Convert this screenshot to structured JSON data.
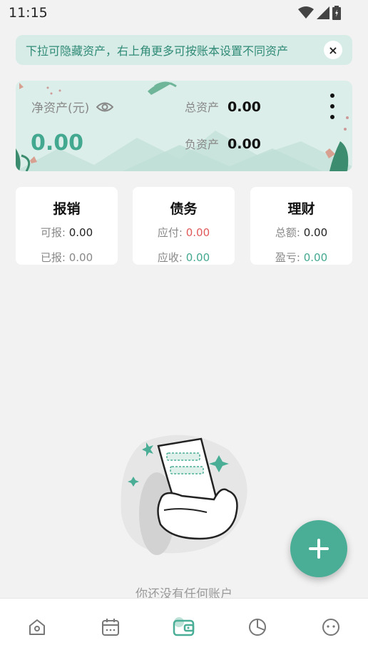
{
  "status_bar": {
    "time": "11:15"
  },
  "tip": {
    "text": "下拉可隐藏资产，右上角更多可按账本设置不同资产",
    "close_glyph": "×"
  },
  "assets": {
    "net_label": "净资产(元)",
    "net_value": "0.00",
    "total_label": "总资产",
    "total_value": "0.00",
    "debt_label": "负资产",
    "debt_value": "0.00"
  },
  "cards": {
    "reimburse": {
      "title": "报销",
      "line1_label": "可报:",
      "line1_value": "0.00",
      "line2_label": "已报:",
      "line2_value": "0.00"
    },
    "debt": {
      "title": "债务",
      "line1_label": "应付:",
      "line1_value": "0.00",
      "line2_label": "应收:",
      "line2_value": "0.00"
    },
    "finance": {
      "title": "理财",
      "line1_label": "总额:",
      "line1_value": "0.00",
      "line2_label": "盈亏:",
      "line2_value": "0.00"
    }
  },
  "empty_state": {
    "text": "你还没有任何账户"
  },
  "colors": {
    "accent": "#4aae96",
    "negative": "#e05a5a",
    "tip_bg": "#d7ece7"
  },
  "nav": {
    "items": [
      {
        "icon": "home-icon"
      },
      {
        "icon": "calendar-icon"
      },
      {
        "icon": "wallet-icon",
        "active": true
      },
      {
        "icon": "pie-chart-icon"
      },
      {
        "icon": "profile-face-icon"
      }
    ]
  }
}
